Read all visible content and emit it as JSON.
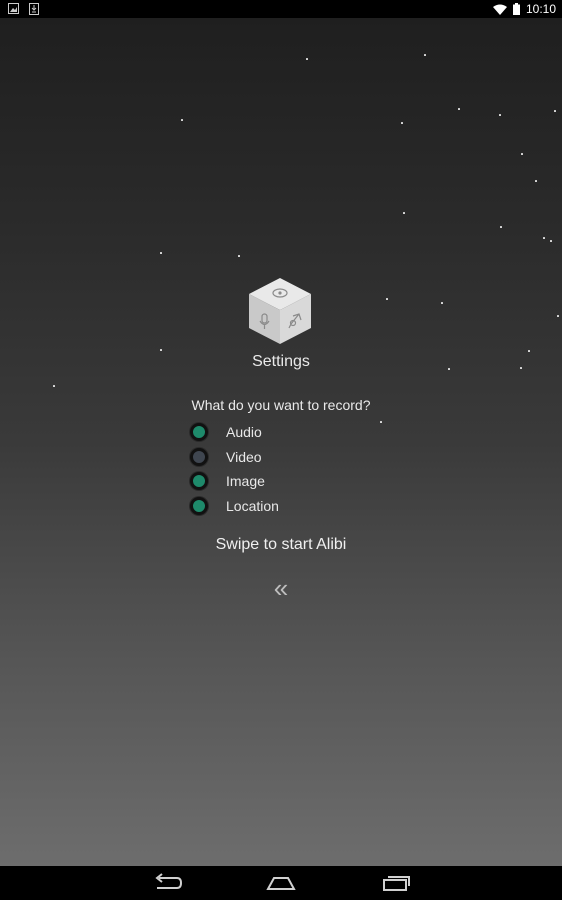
{
  "status_bar": {
    "time": "10:10",
    "left_icons": [
      "image-notification-icon",
      "download-notification-icon"
    ],
    "right_icons": [
      "wifi-icon",
      "battery-icon"
    ]
  },
  "app": {
    "logo_icon": "alibi-cube-icon",
    "title": "Settings",
    "question": "What do you want to record?",
    "options": [
      {
        "label": "Audio",
        "checked": true
      },
      {
        "label": "Video",
        "checked": false
      },
      {
        "label": "Image",
        "checked": true
      },
      {
        "label": "Location",
        "checked": true
      }
    ],
    "swipe_text": "Swipe to start Alibi",
    "swipe_hint": "«"
  },
  "colors": {
    "accent": "#1e8a6b",
    "unchecked": "#3f4650"
  },
  "nav_bar": {
    "buttons": [
      "back-icon",
      "home-icon",
      "recents-icon"
    ]
  }
}
